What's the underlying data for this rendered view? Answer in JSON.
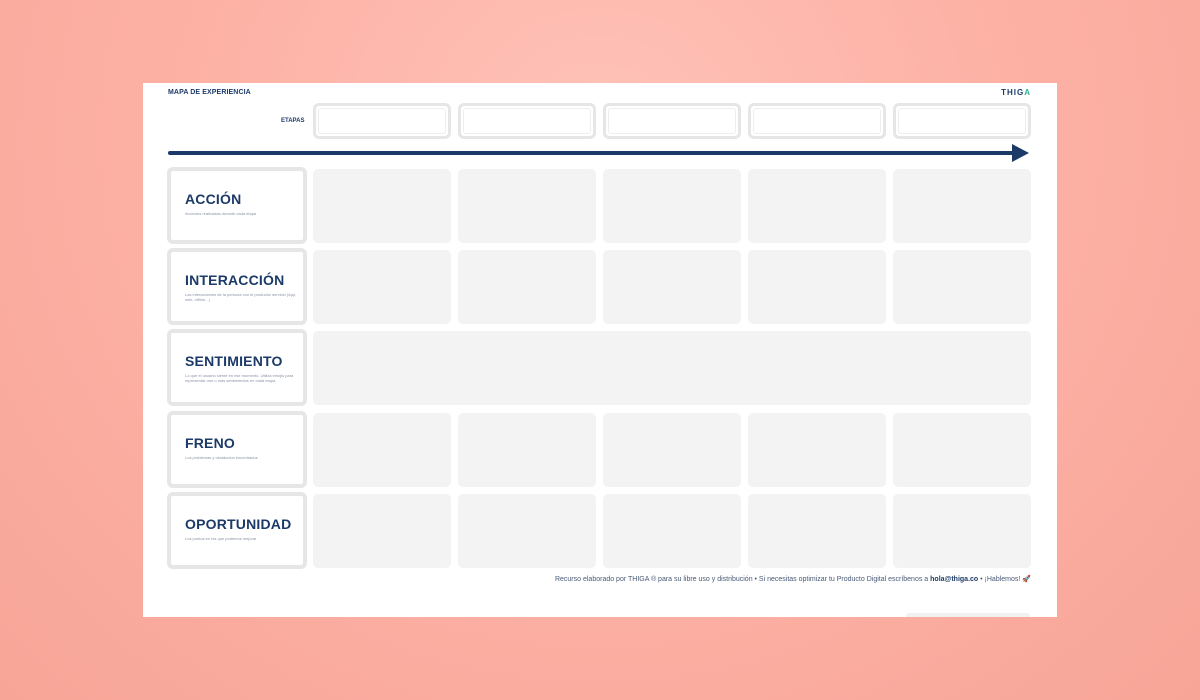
{
  "board": {
    "title": "MAPA DE EXPERIENCIA",
    "logo_main": "THIG",
    "logo_accent": "A"
  },
  "stages": {
    "label": "ETAPAS",
    "count": 5
  },
  "rows": [
    {
      "title": "ACCIÓN",
      "desc": "Acciones realizadas durante cada etapa"
    },
    {
      "title": "INTERACCIÓN",
      "desc": "Las interacciones de la persona con el producto/ servicio (App, web, offline...)"
    },
    {
      "title": "SENTIMIENTO",
      "desc": "Lo que el usuario siente en ese momento. Utiliza emojis para representar uno o más sentimientos en cada etapa."
    },
    {
      "title": "FRENO",
      "desc": "Los problemas y obstáculos encontrados"
    },
    {
      "title": "OPORTUNIDAD",
      "desc": "Los puntos en los que podemos mejorar"
    }
  ],
  "footer": {
    "text_before": "Recurso elaborado por THIGA ® para su libre uso y distribución  •  Si necesitas optimizar tu Producto Digital escríbenos a ",
    "email": "hola@thiga.co",
    "text_after": "  •  ¡Hablemos! ",
    "emoji": "🚀"
  },
  "colors": {
    "background": "#fdb2a6",
    "navy": "#1c3a68",
    "accent": "#2ab39a",
    "cell": "#f3f3f3"
  }
}
